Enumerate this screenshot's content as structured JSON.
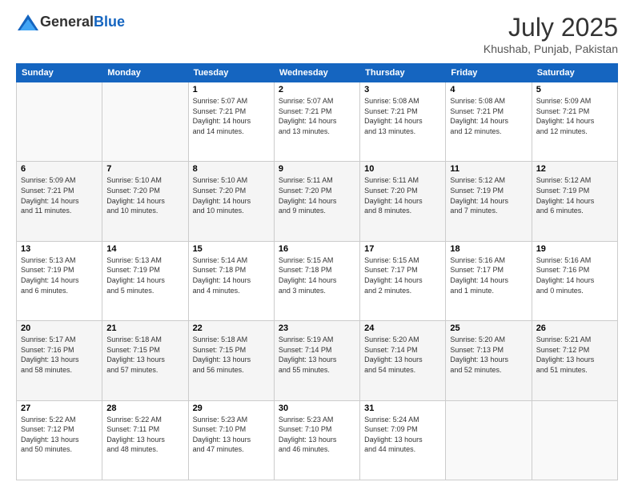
{
  "logo": {
    "general": "General",
    "blue": "Blue"
  },
  "title": {
    "month_year": "July 2025",
    "location": "Khushab, Punjab, Pakistan"
  },
  "headers": [
    "Sunday",
    "Monday",
    "Tuesday",
    "Wednesday",
    "Thursday",
    "Friday",
    "Saturday"
  ],
  "weeks": [
    [
      {
        "day": "",
        "info": ""
      },
      {
        "day": "",
        "info": ""
      },
      {
        "day": "1",
        "info": "Sunrise: 5:07 AM\nSunset: 7:21 PM\nDaylight: 14 hours\nand 14 minutes."
      },
      {
        "day": "2",
        "info": "Sunrise: 5:07 AM\nSunset: 7:21 PM\nDaylight: 14 hours\nand 13 minutes."
      },
      {
        "day": "3",
        "info": "Sunrise: 5:08 AM\nSunset: 7:21 PM\nDaylight: 14 hours\nand 13 minutes."
      },
      {
        "day": "4",
        "info": "Sunrise: 5:08 AM\nSunset: 7:21 PM\nDaylight: 14 hours\nand 12 minutes."
      },
      {
        "day": "5",
        "info": "Sunrise: 5:09 AM\nSunset: 7:21 PM\nDaylight: 14 hours\nand 12 minutes."
      }
    ],
    [
      {
        "day": "6",
        "info": "Sunrise: 5:09 AM\nSunset: 7:21 PM\nDaylight: 14 hours\nand 11 minutes."
      },
      {
        "day": "7",
        "info": "Sunrise: 5:10 AM\nSunset: 7:20 PM\nDaylight: 14 hours\nand 10 minutes."
      },
      {
        "day": "8",
        "info": "Sunrise: 5:10 AM\nSunset: 7:20 PM\nDaylight: 14 hours\nand 10 minutes."
      },
      {
        "day": "9",
        "info": "Sunrise: 5:11 AM\nSunset: 7:20 PM\nDaylight: 14 hours\nand 9 minutes."
      },
      {
        "day": "10",
        "info": "Sunrise: 5:11 AM\nSunset: 7:20 PM\nDaylight: 14 hours\nand 8 minutes."
      },
      {
        "day": "11",
        "info": "Sunrise: 5:12 AM\nSunset: 7:19 PM\nDaylight: 14 hours\nand 7 minutes."
      },
      {
        "day": "12",
        "info": "Sunrise: 5:12 AM\nSunset: 7:19 PM\nDaylight: 14 hours\nand 6 minutes."
      }
    ],
    [
      {
        "day": "13",
        "info": "Sunrise: 5:13 AM\nSunset: 7:19 PM\nDaylight: 14 hours\nand 6 minutes."
      },
      {
        "day": "14",
        "info": "Sunrise: 5:13 AM\nSunset: 7:19 PM\nDaylight: 14 hours\nand 5 minutes."
      },
      {
        "day": "15",
        "info": "Sunrise: 5:14 AM\nSunset: 7:18 PM\nDaylight: 14 hours\nand 4 minutes."
      },
      {
        "day": "16",
        "info": "Sunrise: 5:15 AM\nSunset: 7:18 PM\nDaylight: 14 hours\nand 3 minutes."
      },
      {
        "day": "17",
        "info": "Sunrise: 5:15 AM\nSunset: 7:17 PM\nDaylight: 14 hours\nand 2 minutes."
      },
      {
        "day": "18",
        "info": "Sunrise: 5:16 AM\nSunset: 7:17 PM\nDaylight: 14 hours\nand 1 minute."
      },
      {
        "day": "19",
        "info": "Sunrise: 5:16 AM\nSunset: 7:16 PM\nDaylight: 14 hours\nand 0 minutes."
      }
    ],
    [
      {
        "day": "20",
        "info": "Sunrise: 5:17 AM\nSunset: 7:16 PM\nDaylight: 13 hours\nand 58 minutes."
      },
      {
        "day": "21",
        "info": "Sunrise: 5:18 AM\nSunset: 7:15 PM\nDaylight: 13 hours\nand 57 minutes."
      },
      {
        "day": "22",
        "info": "Sunrise: 5:18 AM\nSunset: 7:15 PM\nDaylight: 13 hours\nand 56 minutes."
      },
      {
        "day": "23",
        "info": "Sunrise: 5:19 AM\nSunset: 7:14 PM\nDaylight: 13 hours\nand 55 minutes."
      },
      {
        "day": "24",
        "info": "Sunrise: 5:20 AM\nSunset: 7:14 PM\nDaylight: 13 hours\nand 54 minutes."
      },
      {
        "day": "25",
        "info": "Sunrise: 5:20 AM\nSunset: 7:13 PM\nDaylight: 13 hours\nand 52 minutes."
      },
      {
        "day": "26",
        "info": "Sunrise: 5:21 AM\nSunset: 7:12 PM\nDaylight: 13 hours\nand 51 minutes."
      }
    ],
    [
      {
        "day": "27",
        "info": "Sunrise: 5:22 AM\nSunset: 7:12 PM\nDaylight: 13 hours\nand 50 minutes."
      },
      {
        "day": "28",
        "info": "Sunrise: 5:22 AM\nSunset: 7:11 PM\nDaylight: 13 hours\nand 48 minutes."
      },
      {
        "day": "29",
        "info": "Sunrise: 5:23 AM\nSunset: 7:10 PM\nDaylight: 13 hours\nand 47 minutes."
      },
      {
        "day": "30",
        "info": "Sunrise: 5:23 AM\nSunset: 7:10 PM\nDaylight: 13 hours\nand 46 minutes."
      },
      {
        "day": "31",
        "info": "Sunrise: 5:24 AM\nSunset: 7:09 PM\nDaylight: 13 hours\nand 44 minutes."
      },
      {
        "day": "",
        "info": ""
      },
      {
        "day": "",
        "info": ""
      }
    ]
  ]
}
